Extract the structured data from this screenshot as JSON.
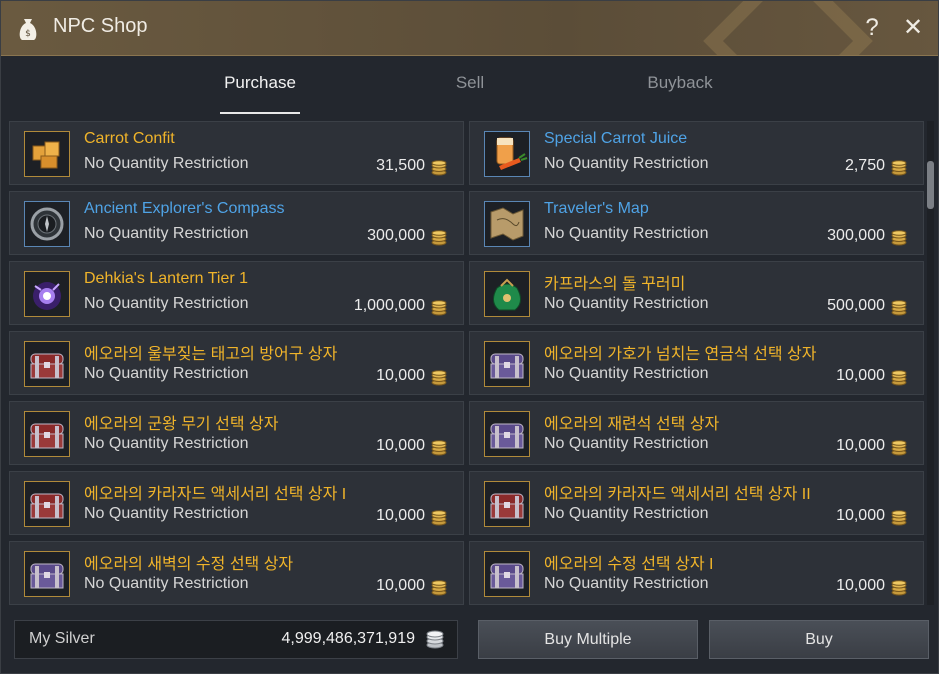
{
  "window": {
    "title": "NPC Shop",
    "help_glyph": "?",
    "close_glyph": "✕"
  },
  "tabs": [
    {
      "label": "Purchase",
      "active": true
    },
    {
      "label": "Sell",
      "active": false
    },
    {
      "label": "Buyback",
      "active": false
    }
  ],
  "items": [
    {
      "name": "Carrot Confit",
      "limit": "No Quantity Restriction",
      "price": "31,500",
      "grade": "gold",
      "icon": "carrot-confit-icon"
    },
    {
      "name": "Special Carrot Juice",
      "limit": "No Quantity Restriction",
      "price": "2,750",
      "grade": "blue",
      "icon": "carrot-juice-icon"
    },
    {
      "name": "Ancient Explorer's Compass",
      "limit": "No Quantity Restriction",
      "price": "300,000",
      "grade": "blue",
      "icon": "compass-icon"
    },
    {
      "name": "Traveler's Map",
      "limit": "No Quantity Restriction",
      "price": "300,000",
      "grade": "blue",
      "icon": "map-icon"
    },
    {
      "name": "Dehkia's Lantern Tier 1",
      "limit": "No Quantity Restriction",
      "price": "1,000,000",
      "grade": "gold",
      "icon": "lantern-icon"
    },
    {
      "name": "카프라스의 돌 꾸러미",
      "limit": "No Quantity Restriction",
      "price": "500,000",
      "grade": "gold",
      "icon": "stone-bundle-icon"
    },
    {
      "name": "에오라의 울부짖는 태고의 방어구 상자",
      "limit": "No Quantity Restriction",
      "price": "10,000",
      "grade": "gold",
      "icon": "treasure-chest-red-icon"
    },
    {
      "name": "에오라의 가호가 넘치는 연금석 선택 상자",
      "limit": "No Quantity Restriction",
      "price": "10,000",
      "grade": "gold",
      "icon": "treasure-chest-purple-icon"
    },
    {
      "name": "에오라의 군왕 무기 선택 상자",
      "limit": "No Quantity Restriction",
      "price": "10,000",
      "grade": "gold",
      "icon": "treasure-chest-red-icon"
    },
    {
      "name": "에오라의 재련석 선택 상자",
      "limit": "No Quantity Restriction",
      "price": "10,000",
      "grade": "gold",
      "icon": "treasure-chest-purple-icon"
    },
    {
      "name": "에오라의 카라자드 액세서리 선택 상자 I",
      "limit": "No Quantity Restriction",
      "price": "10,000",
      "grade": "gold",
      "icon": "treasure-chest-red-icon"
    },
    {
      "name": "에오라의 카라자드 액세서리 선택 상자 II",
      "limit": "No Quantity Restriction",
      "price": "10,000",
      "grade": "gold",
      "icon": "treasure-chest-red-icon"
    },
    {
      "name": "에오라의 새벽의 수정 선택 상자",
      "limit": "No Quantity Restriction",
      "price": "10,000",
      "grade": "gold",
      "icon": "treasure-chest-purple-icon"
    },
    {
      "name": "에오라의 수정 선택 상자 I",
      "limit": "No Quantity Restriction",
      "price": "10,000",
      "grade": "gold",
      "icon": "treasure-chest-purple-icon"
    }
  ],
  "footer": {
    "silver_label": "My Silver",
    "silver_value": "4,999,486,371,919",
    "buy_multiple_label": "Buy Multiple",
    "buy_label": "Buy"
  },
  "colors": {
    "gold_name": "#f0b42a",
    "blue_name": "#4fa3e6",
    "panel_bg": "#23272e",
    "title_bar": "#5b4d38"
  }
}
